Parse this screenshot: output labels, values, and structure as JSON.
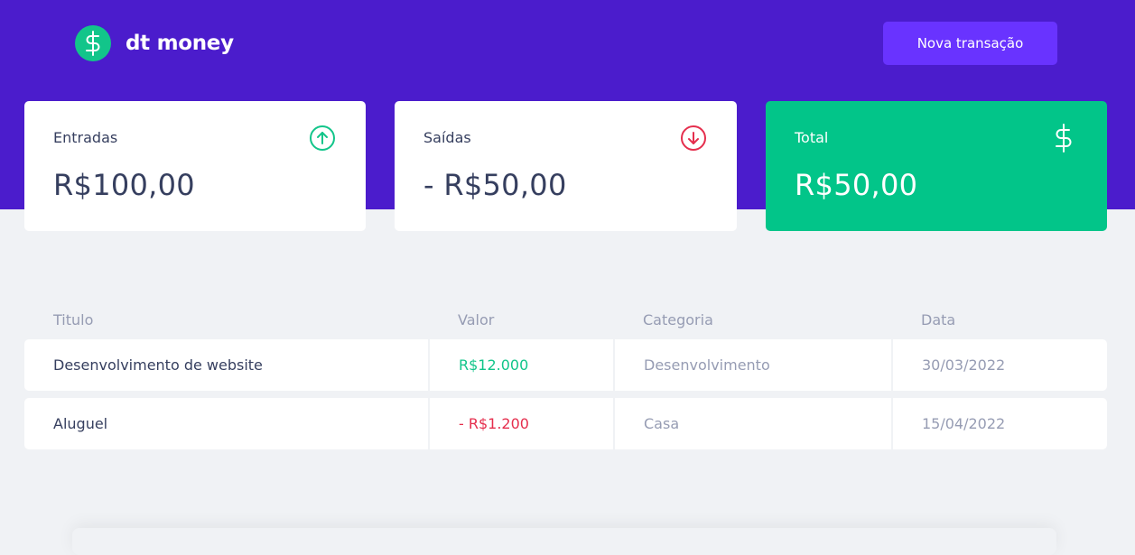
{
  "app": {
    "name": "dt money",
    "new_transaction_label": "Nova transação"
  },
  "summary": {
    "income": {
      "label": "Entradas",
      "value": "R$100,00",
      "icon": "arrow-up-circle-icon"
    },
    "outcome": {
      "label": "Saídas",
      "value": "- R$50,00",
      "icon": "arrow-down-circle-icon"
    },
    "total": {
      "label": "Total",
      "value": "R$50,00",
      "icon": "dollar-icon"
    }
  },
  "table": {
    "headers": [
      "Titulo",
      "Valor",
      "Categoria",
      "Data"
    ],
    "rows": [
      {
        "title": "Desenvolvimento de website",
        "amount": "R$12.000",
        "type": "income",
        "category": "Desenvolvimento",
        "date": "30/03/2022"
      },
      {
        "title": "Aluguel",
        "amount": "- R$1.200",
        "type": "outcome",
        "category": "Casa",
        "date": "15/04/2022"
      }
    ]
  },
  "colors": {
    "header_bg": "#4b1ccc",
    "button_bg": "#6933ff",
    "green": "#12c58a",
    "red": "#e52e4d",
    "text_title": "#363f5f",
    "text_body": "#969cb3",
    "background": "#f0f2f5"
  }
}
